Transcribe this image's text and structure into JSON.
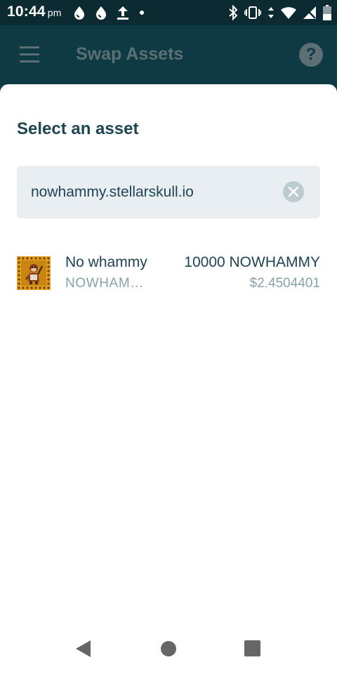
{
  "status_bar": {
    "time": "10:44",
    "ampm": "pm",
    "left_icons": [
      "drop-icon",
      "drop-icon",
      "upload-icon",
      "dot-icon"
    ],
    "right_icons": [
      "bluetooth-icon",
      "vibrate-icon",
      "data-arrows-icon",
      "wifi-icon",
      "no-signal-icon",
      "battery-icon"
    ]
  },
  "app_bar": {
    "title": "Swap Assets",
    "menu_icon": "hamburger-icon",
    "help_icon": "help-icon",
    "help_glyph": "?"
  },
  "sheet": {
    "title": "Select an asset",
    "search": {
      "value": "nowhammy.stellarskull.io",
      "clear_icon": "close-icon"
    },
    "assets": [
      {
        "name": "No whammy",
        "code": "NOWHAM…",
        "balance": "10000 NOWHAMMY",
        "value": "$2.4504401",
        "icon": "asset-logo"
      }
    ]
  },
  "nav_bar": {
    "icons": [
      "back-icon",
      "home-icon",
      "recents-icon"
    ]
  },
  "colors": {
    "status_bar_bg": "#0b2a32",
    "app_bar_bg": "#0e3a44",
    "title_text": "#1d4553",
    "muted_text": "#8aa0a8",
    "search_bg": "#e8eef1"
  }
}
